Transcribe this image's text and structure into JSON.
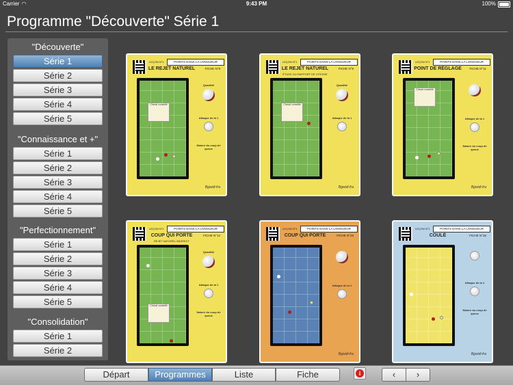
{
  "status": {
    "carrier": "Carrier",
    "time": "9:43 PM",
    "battery": "100%"
  },
  "page_title": "Programme \"Découverte\" Série 1",
  "sidebar": {
    "groups": [
      {
        "title": "\"Découverte\"",
        "items": [
          "Série 1",
          "Série 2",
          "Série 3",
          "Série 4",
          "Série 5"
        ],
        "active_index": 0
      },
      {
        "title": "\"Connaissance et +\"",
        "items": [
          "Série 1",
          "Série 2",
          "Série 3",
          "Série 4",
          "Série 5"
        ]
      },
      {
        "title": "\"Perfectionnement\"",
        "items": [
          "Série 1",
          "Série 2",
          "Série 3",
          "Série 4",
          "Série 5"
        ]
      },
      {
        "title": "\"Consolidation\"",
        "items": [
          "Série 1",
          "Série 2"
        ]
      }
    ]
  },
  "cards": [
    {
      "lecon": "LEÇON N°1",
      "header": "POINTS DANS LA LONGUEUR",
      "fiche": "FICHE N°8",
      "title": "LE REJET NATUREL",
      "subtitle": "",
      "color": "yellow"
    },
    {
      "lecon": "LEÇON N°1",
      "header": "POINTS DANS LA LONGUEUR",
      "fiche": "FICHE N°9",
      "title": "LE REJET NATUREL",
      "subtitle": "ÉTUDE DU RAPPORT DE VITESSE",
      "color": "yellow"
    },
    {
      "lecon": "LEÇON N°1",
      "header": "POINTS DANS LA LONGUEUR",
      "fiche": "FICHE N°11",
      "title": "POINT DE RÉGLAGE",
      "subtitle": "",
      "color": "yellow"
    },
    {
      "lecon": "LEÇON N°1",
      "header": "POINTS DANS LA LONGUEUR",
      "fiche": "FICHE N°12",
      "title": "COUP QUI PORTE",
      "subtitle": "REJET NATUREL INDIRECT",
      "color": "yellow"
    },
    {
      "lecon": "LEÇON N°1",
      "header": "POINTS DANS LA LONGUEUR",
      "fiche": "FICHE N°25",
      "title": "COUP QUI PORTE",
      "subtitle": "",
      "color": "orange"
    },
    {
      "lecon": "LEÇON N°1",
      "header": "POINTS DANS LA LONGUEUR",
      "fiche": "FICHE N°26",
      "title": "COULÉ",
      "subtitle": "",
      "color": "blue"
    }
  ],
  "card_labels": {
    "quantite": "Quantité",
    "attaque": "Attaque de la 1",
    "nature": "Nature du coup de queue",
    "cheval": "Cheval conseillé",
    "brand": "Bgwidi-fra"
  },
  "toolbar": {
    "tabs": [
      "Départ",
      "Programmes",
      "Liste",
      "Fiche"
    ],
    "active_tab": "Programmes",
    "info_icon": "info-icon",
    "prev": "‹",
    "next": "›"
  }
}
